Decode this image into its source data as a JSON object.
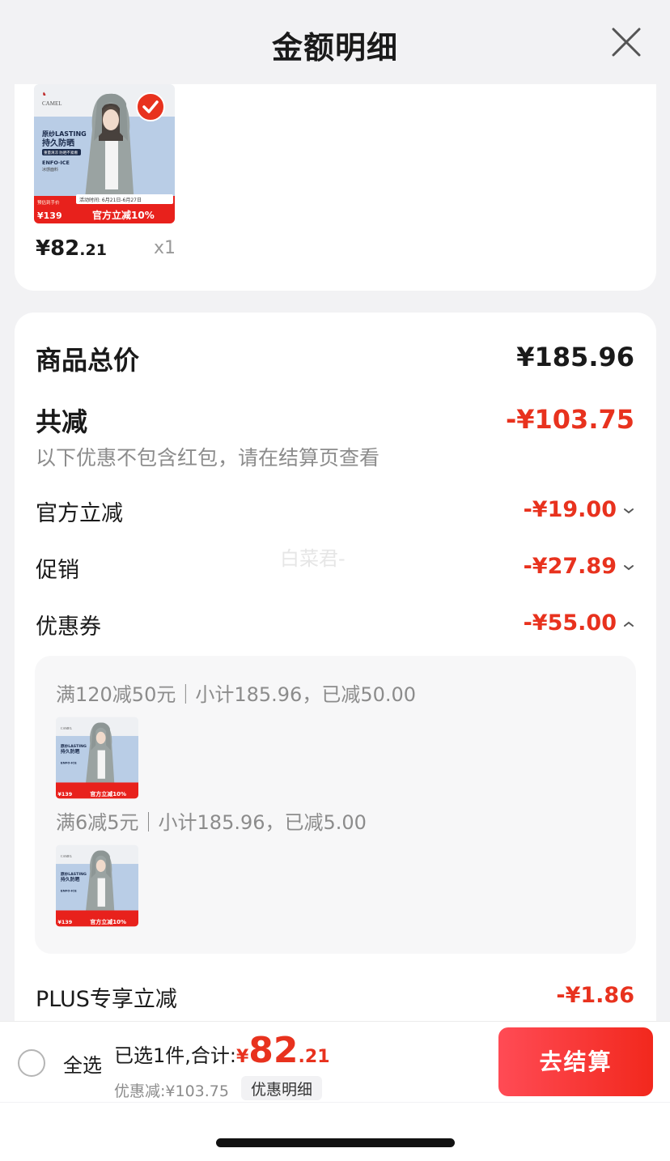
{
  "header": {
    "title": "金额明细"
  },
  "product": {
    "price_int": "¥82",
    "price_dec": ".21",
    "quantity": "x1",
    "image": {
      "brand": "CAMEL",
      "line1": "原纱LASTING",
      "line2": "持久防晒",
      "subtitle": "重量清凉 防晒不紧绷",
      "tech": "ENFO·ICE",
      "tech_sub": "冰感面料",
      "activity": "活动时间: 6月21日-6月27日",
      "preorder": "预估到手价",
      "price": "¥139",
      "promo": "官方立减10%"
    },
    "checked": true
  },
  "summary": {
    "total_label": "商品总价",
    "total_value": "¥185.96",
    "reduce_label": "共减",
    "reduce_value": "-¥103.75",
    "note": "以下优惠不包含红包，请在结算页查看",
    "items": [
      {
        "label": "官方立减",
        "value": "-¥19.00",
        "expanded": false
      },
      {
        "label": "促销",
        "value": "-¥27.89",
        "expanded": false
      },
      {
        "label": "优惠券",
        "value": "-¥55.00",
        "expanded": true
      }
    ],
    "coupons": [
      {
        "text": "满120减50元｜小计185.96，已减50.00"
      },
      {
        "text": "满6减5元｜小计185.96，已减5.00"
      }
    ],
    "plus_label": "PLUS专享立减",
    "plus_value": "-¥1.86"
  },
  "watermark": "白菜君-",
  "bottom_bar": {
    "select_all": "全选",
    "selected_text": "已选1件,合计:",
    "total_symbol": "¥",
    "total_int": "82",
    "total_dec": ".21",
    "discount_text": "优惠减:¥103.75",
    "detail_link": "优惠明细",
    "checkout": "去结算"
  },
  "colors": {
    "accent": "#e8321e",
    "checkout_gradient_start": "#ff4b55",
    "checkout_gradient_end": "#f2281d"
  }
}
